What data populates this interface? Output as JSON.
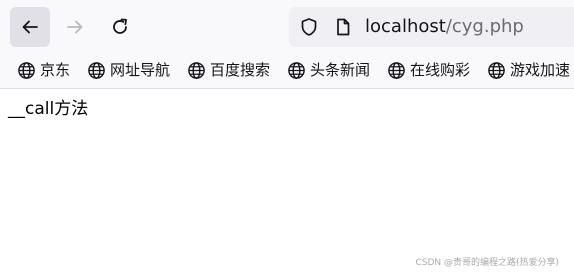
{
  "toolbar": {
    "back_icon": "back-arrow-icon",
    "forward_icon": "forward-arrow-icon",
    "reload_icon": "reload-icon"
  },
  "urlbar": {
    "host": "localhost",
    "path": "/cyg.php",
    "shield_icon": "shield-icon",
    "page_icon": "page-icon"
  },
  "bookmarks": [
    {
      "label": "京东",
      "icon": "globe-icon"
    },
    {
      "label": "网址导航",
      "icon": "globe-icon"
    },
    {
      "label": "百度搜索",
      "icon": "globe-icon"
    },
    {
      "label": "头条新闻",
      "icon": "globe-icon"
    },
    {
      "label": "在线购彩",
      "icon": "globe-icon"
    },
    {
      "label": "游戏加速",
      "icon": "globe-icon"
    }
  ],
  "content": {
    "text": "__call方法"
  },
  "watermark": "CSDN @贵哥的编程之路(热爱分享)",
  "colors": {
    "toolbar_bg": "#f9f9fb",
    "urlbar_bg": "#f0f0f4",
    "back_button_bg": "#e0e0e6",
    "text": "#15141a",
    "url_path": "#6b6b75"
  }
}
